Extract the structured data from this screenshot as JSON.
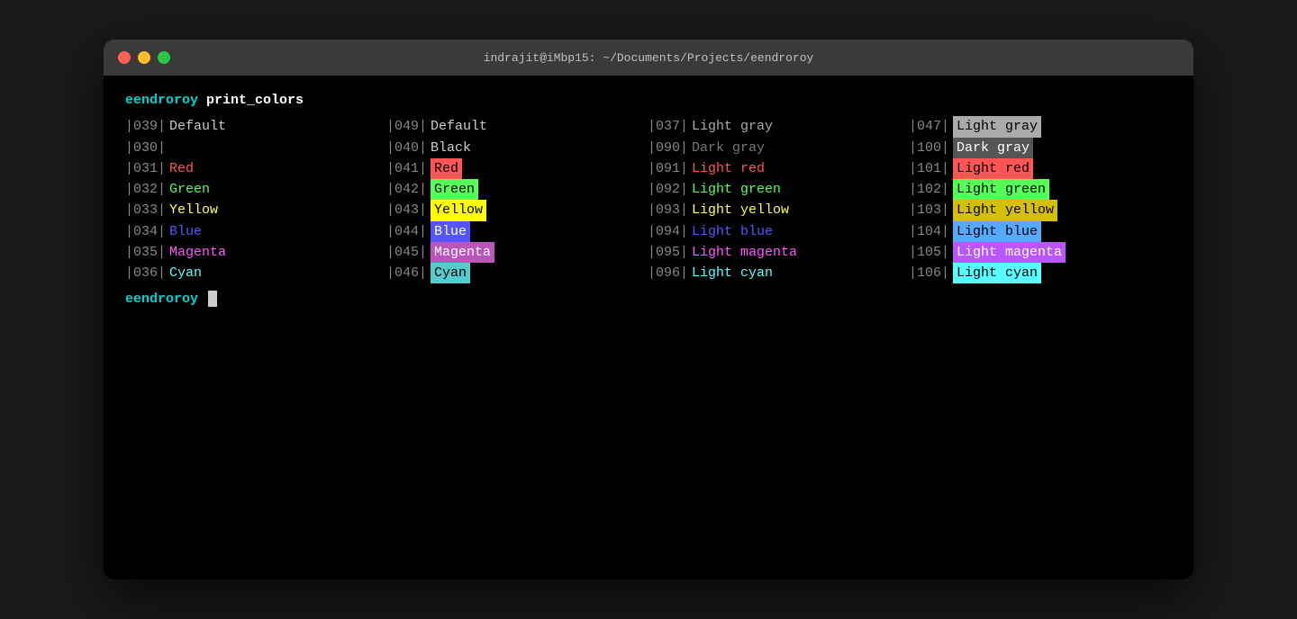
{
  "titlebar": {
    "title": "indrajit@iMbp15: ~/Documents/Projects/eendroroy"
  },
  "terminal": {
    "prompt": "eendroroy",
    "command": "print_colors",
    "columns": [
      [
        {
          "code": "|039|",
          "label": "Default",
          "style": "default"
        },
        {
          "code": "|030|",
          "label": "",
          "style": "plain"
        },
        {
          "code": "|031|",
          "label": "Red",
          "style": "red"
        },
        {
          "code": "|032|",
          "label": "Green",
          "style": "green"
        },
        {
          "code": "|033|",
          "label": "Yellow",
          "style": "yellow"
        },
        {
          "code": "|034|",
          "label": "Blue",
          "style": "blue"
        },
        {
          "code": "|035|",
          "label": "Magenta",
          "style": "magenta"
        },
        {
          "code": "|036|",
          "label": "Cyan",
          "style": "cyan"
        }
      ],
      [
        {
          "code": "|049|",
          "label": "Default",
          "style": "default"
        },
        {
          "code": "|040|",
          "label": "Black",
          "style": "plain"
        },
        {
          "code": "|041|",
          "label": "Red",
          "style": "bg-red"
        },
        {
          "code": "|042|",
          "label": "Green",
          "style": "bg-green"
        },
        {
          "code": "|043|",
          "label": "Yellow",
          "style": "bg-yellow"
        },
        {
          "code": "|044|",
          "label": "Blue",
          "style": "bg-blue"
        },
        {
          "code": "|045|",
          "label": "Magenta",
          "style": "bg-magenta"
        },
        {
          "code": "|046|",
          "label": "Cyan",
          "style": "bg-cyan"
        }
      ],
      [
        {
          "code": "|037|",
          "label": "Light gray",
          "style": "gray"
        },
        {
          "code": "|090|",
          "label": "Dark gray",
          "style": "dark-gray"
        },
        {
          "code": "|091|",
          "label": "Light red",
          "style": "red"
        },
        {
          "code": "|092|",
          "label": "Light green",
          "style": "green"
        },
        {
          "code": "|093|",
          "label": "Light yellow",
          "style": "yellow"
        },
        {
          "code": "|094|",
          "label": "Light blue",
          "style": "blue"
        },
        {
          "code": "|095|",
          "label": "Light magenta",
          "style": "magenta"
        },
        {
          "code": "|096|",
          "label": "Light cyan",
          "style": "cyan"
        }
      ],
      [
        {
          "code": "|047|",
          "label": "Light gray",
          "style": "bg-light-gray"
        },
        {
          "code": "|100|",
          "label": "Dark gray",
          "style": "bg-dark-gray"
        },
        {
          "code": "|101|",
          "label": "Light red",
          "style": "bg-red"
        },
        {
          "code": "|102|",
          "label": "Light green",
          "style": "bg-light-green"
        },
        {
          "code": "|103|",
          "label": "Light yellow",
          "style": "bg-light-yellow"
        },
        {
          "code": "|104|",
          "label": "Light blue",
          "style": "bg-light-blue"
        },
        {
          "code": "|105|",
          "label": "Light magenta",
          "style": "bg-light-magenta"
        },
        {
          "code": "|106|",
          "label": "Light cyan",
          "style": "bg-light-cyan"
        }
      ]
    ],
    "prompt2": "eendroroy"
  }
}
